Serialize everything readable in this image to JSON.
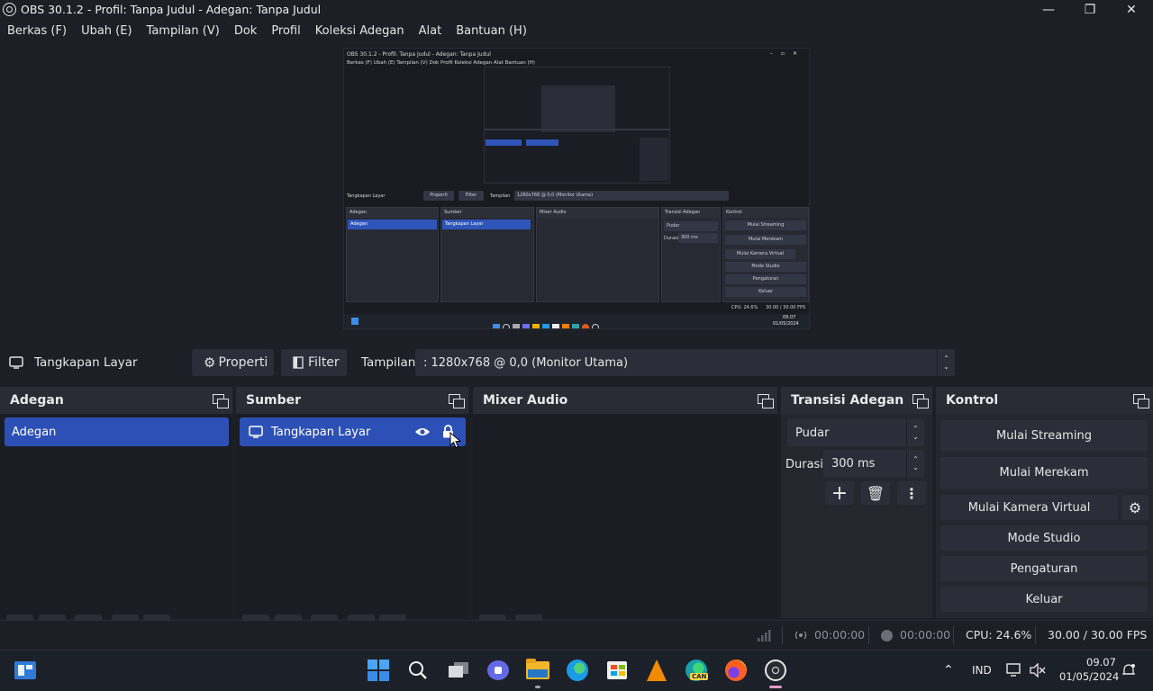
{
  "window": {
    "title": "OBS 30.1.2 - Profil: Tanpa Judul - Adegan: Tanpa Judul"
  },
  "menu": [
    "Berkas (F)",
    "Ubah (E)",
    "Tampilan (V)",
    "Dok",
    "Profil",
    "Koleksi Adegan",
    "Alat",
    "Bantuan (H)"
  ],
  "source_toolbar": {
    "source_name": "Tangkapan Layar",
    "properties_label": "Properti",
    "filter_label": "Filter",
    "display_label": "Tampilan",
    "display_value": ": 1280x768 @ 0,0 (Monitor Utama)"
  },
  "docks": {
    "scenes": {
      "title": "Adegan",
      "items": [
        "Adegan"
      ]
    },
    "sources": {
      "title": "Sumber",
      "items": [
        "Tangkapan Layar"
      ]
    },
    "mixer": {
      "title": "Mixer Audio"
    },
    "transitions": {
      "title": "Transisi Adegan",
      "transition_value": "Pudar",
      "duration_label": "Durasi",
      "duration_value": "300 ms"
    },
    "controls": {
      "title": "Kontrol",
      "start_streaming": "Mulai Streaming",
      "start_recording": "Mulai Merekam",
      "start_virtual_camera": "Mulai Kamera Virtual",
      "studio_mode": "Mode Studio",
      "settings": "Pengaturan",
      "exit": "Keluar"
    }
  },
  "status": {
    "stream_time": "00:00:00",
    "record_time": "00:00:00",
    "cpu": "CPU: 24.6%",
    "fps": "30.00 / 30.00 FPS"
  },
  "taskbar": {
    "language": "IND",
    "time": "09.07",
    "date": "01/05/2024",
    "apps": [
      "start-icon",
      "search-icon",
      "task-view-icon",
      "chat-icon",
      "file-explorer-icon",
      "edge-icon",
      "store-icon",
      "vlc-icon",
      "edge-canary-icon",
      "firefox-icon",
      "obs-icon"
    ]
  },
  "preview": {
    "title": "OBS 30.1.2 - Profil: Tanpa Judul - Adegan: Tanpa Judul",
    "menu": "Berkas (F)  Ubah (E)  Tampilan (V)  Dok  Profil  Koleksi Adegan  Alat  Bantuan (H)",
    "source_name": "Tangkapan Layar",
    "properties": "Properti",
    "filter": "Filter",
    "display": "Tampilan",
    "display_value": "1280x768 @ 0,0 (Monitor Utama)",
    "scenes": "Adegan",
    "scene_item": "Adegan",
    "sources": "Sumber",
    "source_item": "Tangkapan Layar",
    "mixer": "Mixer Audio",
    "transitions": "Transisi Adegan",
    "transition_value": "Pudar",
    "duration_label": "Durasi",
    "duration_value": "300 ms",
    "controls": "Kontrol",
    "btn_stream": "Mulai Streaming",
    "btn_record": "Mulai Merekam",
    "btn_vcam": "Mulai Kamera Virtual",
    "btn_studio": "Mode Studio",
    "btn_settings": "Pengaturan",
    "btn_exit": "Keluar",
    "cpu": "CPU: 24.6%",
    "fps": "30.00 / 30.00 FPS",
    "time": "09.07",
    "date": "01/05/2024"
  }
}
